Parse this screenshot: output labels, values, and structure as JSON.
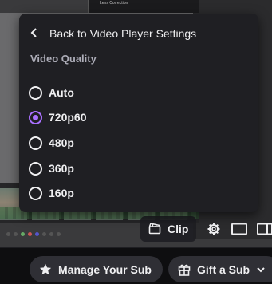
{
  "video": {
    "editor_label": "Lens Correction"
  },
  "quality_menu": {
    "back_label": "Back to Video Player Settings",
    "section_title": "Video Quality",
    "options": [
      {
        "label": "Auto",
        "selected": false
      },
      {
        "label": "720p60",
        "selected": true
      },
      {
        "label": "480p",
        "selected": false
      },
      {
        "label": "360p",
        "selected": false
      },
      {
        "label": "160p",
        "selected": false
      }
    ]
  },
  "player_controls": {
    "clip_label": "Clip"
  },
  "bottom_bar": {
    "manage_sub_label": "Manage Your Sub",
    "gift_sub_label": "Gift a Sub"
  },
  "colors": {
    "accent": "#a970ff",
    "menu_bg": "#1f1f23",
    "button_bg": "#2f2f35"
  },
  "icons": {
    "back": "chevron-left-icon",
    "clip": "clapperboard-icon",
    "settings": "gear-icon",
    "theatre": "theatre-mode-icon",
    "sidebar": "sidebar-icon",
    "manage_sub": "star-icon",
    "gift": "gift-icon",
    "dropdown": "chevron-down-icon"
  }
}
